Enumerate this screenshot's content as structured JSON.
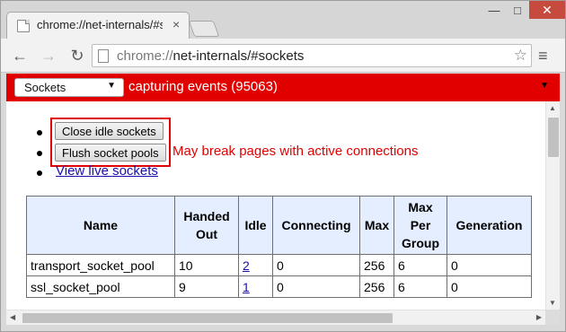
{
  "browser": {
    "tab_title": "chrome://net-internals/#s",
    "tab_close": "×",
    "url_scheme": "chrome://",
    "url_rest": "net-internals/#sockets",
    "window_controls": {
      "minimize": "—",
      "maximize": "□",
      "close": "✕"
    },
    "icons": {
      "back": "←",
      "forward": "→",
      "reload": "↻",
      "star": "☆",
      "menu": "≡"
    }
  },
  "capture_bar": {
    "view_select": "Sockets",
    "status": "capturing events (95063)",
    "background": "#e00000"
  },
  "actions": {
    "close_idle": "Close idle sockets",
    "flush_pools": "Flush socket pools",
    "warning": "May break pages with active connections",
    "view_live": "View live sockets"
  },
  "table": {
    "headers": [
      "Name",
      "Handed Out",
      "Idle",
      "Connecting",
      "Max",
      "Max Per Group",
      "Generation"
    ],
    "rows": [
      [
        "transport_socket_pool",
        "10",
        "2",
        "0",
        "256",
        "6",
        "0"
      ],
      [
        "ssl_socket_pool",
        "9",
        "1",
        "0",
        "256",
        "6",
        "0"
      ]
    ]
  },
  "colors": {
    "accent_red": "#e00000",
    "header_bg": "#e4eeff",
    "link": "#1a0dab"
  }
}
